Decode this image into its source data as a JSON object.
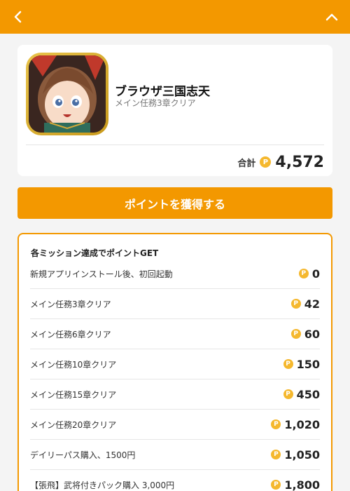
{
  "header": {
    "back_icon": "chevron-left-icon",
    "collapse_icon": "chevron-up-icon",
    "color": "#f39800"
  },
  "app": {
    "title": "ブラウザ三国志天",
    "subtitle": "メイン任務3章クリア",
    "total_label": "合計",
    "total_value": "4,572"
  },
  "cta": {
    "label": "ポイントを獲得する"
  },
  "missions": {
    "heading": "各ミッション達成でポイントGET",
    "items": [
      {
        "name": "新規アプリインストール後、初回起動",
        "points": "0"
      },
      {
        "name": "メイン任務3章クリア",
        "points": "42"
      },
      {
        "name": "メイン任務6章クリア",
        "points": "60"
      },
      {
        "name": "メイン任務10章クリア",
        "points": "150"
      },
      {
        "name": "メイン任務15章クリア",
        "points": "450"
      },
      {
        "name": "メイン任務20章クリア",
        "points": "1,020"
      },
      {
        "name": "デイリーパス購入、1500円",
        "points": "1,050"
      },
      {
        "name": "【張飛】武将付きパック購入 3,000円",
        "points": "1,800"
      }
    ]
  },
  "coin_glyph": "P"
}
